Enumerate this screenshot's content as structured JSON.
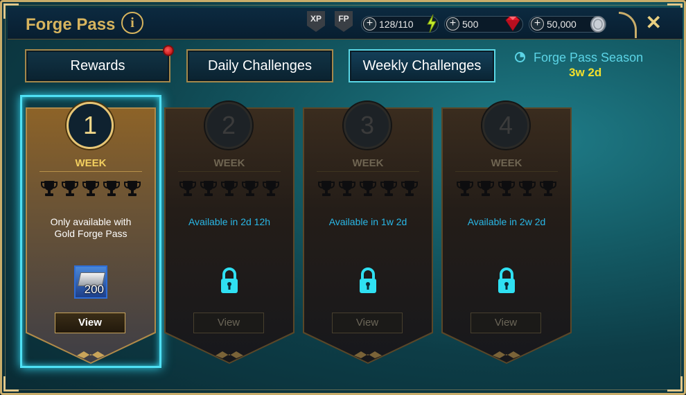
{
  "header": {
    "title": "Forge Pass",
    "info_icon": "i",
    "badges": [
      "XP",
      "FP"
    ],
    "energy": "128/110",
    "rubies": "500",
    "silver": "50,000",
    "close_icon": "✕"
  },
  "tabs": [
    {
      "label": "Rewards",
      "has_notification": true
    },
    {
      "label": "Daily Challenges"
    },
    {
      "label": "Weekly Challenges",
      "active": true
    }
  ],
  "season": {
    "label": "Forge Pass Season",
    "time_left": "3w 2d"
  },
  "cards": [
    {
      "number": "1",
      "week": "WEEK",
      "status": "Only available with Gold Forge Pass",
      "reward_qty": "200",
      "button": "View",
      "active": true,
      "trophies": 5
    },
    {
      "number": "2",
      "week": "WEEK",
      "status": "Available in 2d 12h",
      "button": "View",
      "locked": true,
      "trophies": 5
    },
    {
      "number": "3",
      "week": "WEEK",
      "status": "Available in 1w 2d",
      "button": "View",
      "locked": true,
      "trophies": 5
    },
    {
      "number": "4",
      "week": "WEEK",
      "status": "Available in 2w 2d",
      "button": "View",
      "locked": true,
      "trophies": 5
    }
  ],
  "colors": {
    "accent_gold": "#d7b45e",
    "accent_cyan": "#5bd4e6",
    "season_time": "#f2e02c",
    "status_blue": "#29b7e6"
  }
}
